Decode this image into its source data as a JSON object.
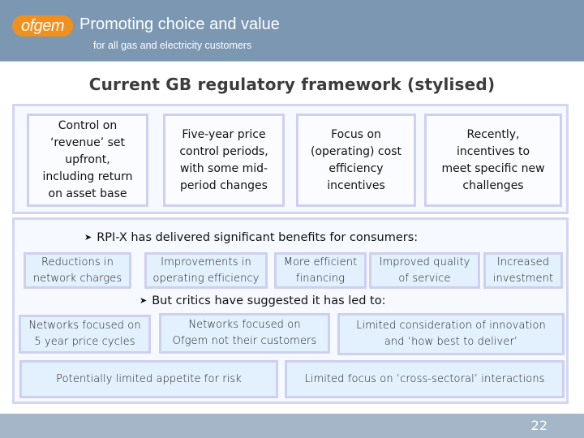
{
  "header": {
    "logo_text": "ofgem",
    "tagline": "Promoting choice and value",
    "subtagline": "for all gas and electricity customers"
  },
  "title": "Current GB regulatory framework (stylised)",
  "framework_boxes": [
    {
      "label": "Control on\n‘revenue’ set\nupfront,\nincluding return\non asset base"
    },
    {
      "label": "Five-year price\ncontrol periods,\nwith some mid-\nperiod changes"
    },
    {
      "label": "Focus on\n(operating) cost\nefficiency\nincentives"
    },
    {
      "label": "Recently,\nincentives to\nmeet specific new\nchallenges"
    }
  ],
  "benefits": {
    "heading": "RPI-X has delivered significant benefits for consumers:",
    "bullet_icon": "arrow-bullet-icon",
    "items": [
      {
        "label": "Reductions in\nnetwork charges"
      },
      {
        "label": "Improvements in\noperating efficiency"
      },
      {
        "label": "More efficient\nfinancing"
      },
      {
        "label": "Improved quality\nof service"
      },
      {
        "label": "Increased\ninvestment"
      }
    ]
  },
  "criticisms": {
    "heading": "But critics have suggested it has led to:",
    "bullet_icon": "arrow-bullet-icon",
    "items": [
      {
        "label": "Networks focused on\n5 year price cycles"
      },
      {
        "label": "Networks focused on\nOfgem not their customers"
      },
      {
        "label": "Limited consideration of innovation\nand ‘how best to deliver’"
      },
      {
        "label": "Potentially limited appetite for risk"
      },
      {
        "label": "Limited focus on ‘cross-sectoral’ interactions"
      }
    ]
  },
  "footer": {
    "page_number": "22"
  }
}
